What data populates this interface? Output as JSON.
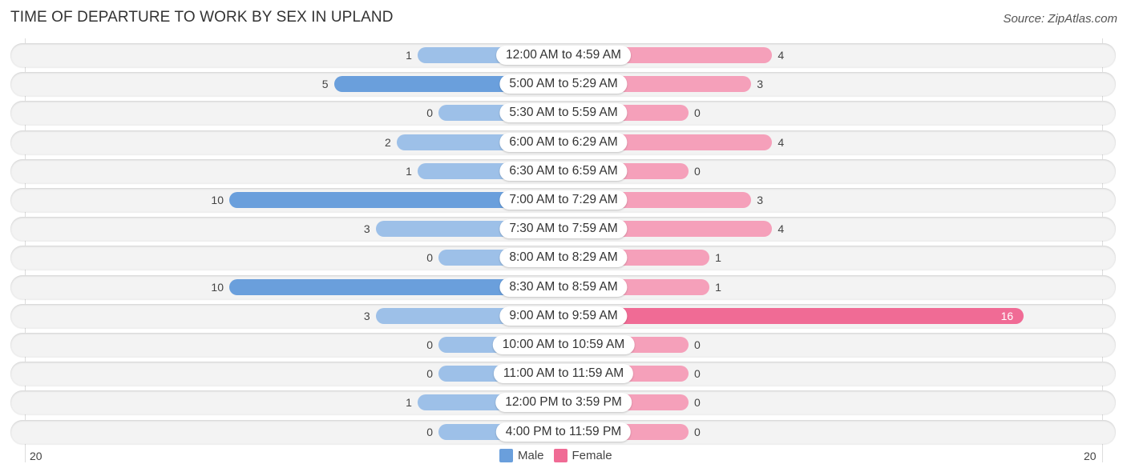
{
  "chart_data": {
    "type": "bar",
    "orientation": "horizontal-diverging",
    "title": "TIME OF DEPARTURE TO WORK BY SEX IN UPLAND",
    "source": "Source: ZipAtlas.com",
    "categories": [
      "12:00 AM to 4:59 AM",
      "5:00 AM to 5:29 AM",
      "5:30 AM to 5:59 AM",
      "6:00 AM to 6:29 AM",
      "6:30 AM to 6:59 AM",
      "7:00 AM to 7:29 AM",
      "7:30 AM to 7:59 AM",
      "8:00 AM to 8:29 AM",
      "8:30 AM to 8:59 AM",
      "9:00 AM to 9:59 AM",
      "10:00 AM to 10:59 AM",
      "11:00 AM to 11:59 AM",
      "12:00 PM to 3:59 PM",
      "4:00 PM to 11:59 PM"
    ],
    "series": [
      {
        "name": "Male",
        "color": "#6a9fdc",
        "values": [
          1,
          5,
          0,
          2,
          1,
          10,
          3,
          0,
          10,
          3,
          0,
          0,
          1,
          0
        ]
      },
      {
        "name": "Female",
        "color": "#f06b95",
        "values": [
          4,
          3,
          0,
          4,
          0,
          3,
          4,
          1,
          1,
          16,
          0,
          0,
          0,
          0
        ]
      }
    ],
    "axis": {
      "left_label": "20",
      "right_label": "20",
      "range": [
        -20,
        20
      ]
    },
    "legend": {
      "position": "bottom-center",
      "items": [
        "Male",
        "Female"
      ]
    }
  }
}
